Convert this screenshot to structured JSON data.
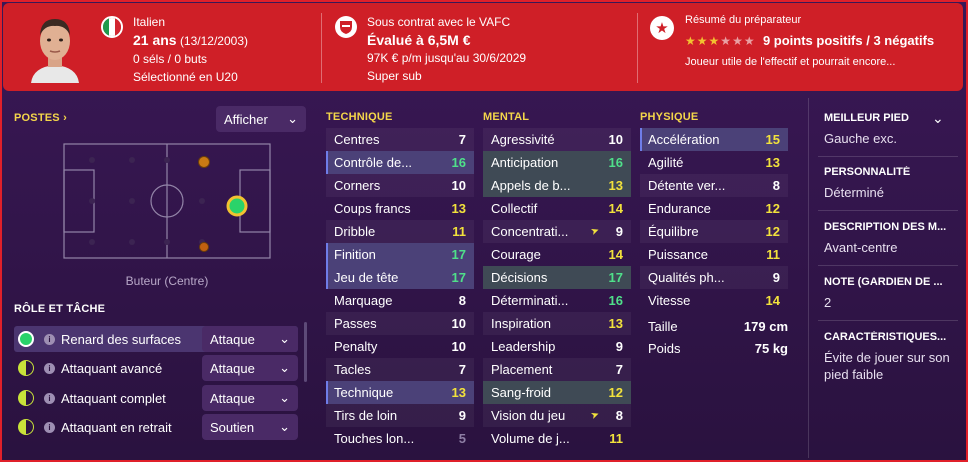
{
  "header": {
    "nationality": "Italien",
    "age": "21 ans",
    "dob": "(13/12/2003)",
    "caps": "0 séls / 0 buts",
    "u20": "Sélectionné en U20",
    "contract": "Sous contrat avec le VAFC",
    "value": "Évalué à 6,5M €",
    "wage": "97K € p/m jusqu'au 30/6/2029",
    "role_status": "Super sub",
    "scout_title": "Résumé du préparateur",
    "stars_filled": 3,
    "stars_total": 6,
    "scout_summary": "9 points positifs / 3 négatifs",
    "scout_text": "Joueur utile de l'effectif et pourrait encore...",
    "club_badge": "VAFC"
  },
  "positions": {
    "title": "POSTES",
    "button": "Afficher",
    "label": "Buteur (Centre)"
  },
  "roles": {
    "title": "RÔLE ET TÂCHE",
    "items": [
      {
        "name": "Renard des surfaces",
        "duty": "Attaque"
      },
      {
        "name": "Attaquant avancé",
        "duty": "Attaque"
      },
      {
        "name": "Attaquant complet",
        "duty": "Attaque"
      },
      {
        "name": "Attaquant en retrait",
        "duty": "Soutien"
      }
    ]
  },
  "technique": {
    "title": "TECHNIQUE",
    "rows": [
      {
        "name": "Centres",
        "value": "7",
        "color": "white"
      },
      {
        "name": "Contrôle de...",
        "value": "16",
        "color": "green"
      },
      {
        "name": "Corners",
        "value": "10",
        "color": "white"
      },
      {
        "name": "Coups francs",
        "value": "13",
        "color": "yellow"
      },
      {
        "name": "Dribble",
        "value": "11",
        "color": "yellow"
      },
      {
        "name": "Finition",
        "value": "17",
        "color": "green"
      },
      {
        "name": "Jeu de tête",
        "value": "17",
        "color": "green"
      },
      {
        "name": "Marquage",
        "value": "8",
        "color": "white"
      },
      {
        "name": "Passes",
        "value": "10",
        "color": "white"
      },
      {
        "name": "Penalty",
        "value": "10",
        "color": "white"
      },
      {
        "name": "Tacles",
        "value": "7",
        "color": "white"
      },
      {
        "name": "Technique",
        "value": "13",
        "color": "yellow"
      },
      {
        "name": "Tirs de loin",
        "value": "9",
        "color": "white"
      },
      {
        "name": "Touches lon...",
        "value": "5",
        "color": "grey"
      }
    ]
  },
  "mental": {
    "title": "MENTAL",
    "rows": [
      {
        "name": "Agressivité",
        "value": "10",
        "color": "white"
      },
      {
        "name": "Anticipation",
        "value": "16",
        "color": "green"
      },
      {
        "name": "Appels de b...",
        "value": "13",
        "color": "yellow"
      },
      {
        "name": "Collectif",
        "value": "14",
        "color": "yellow"
      },
      {
        "name": "Concentrati...",
        "value": "9",
        "color": "white"
      },
      {
        "name": "Courage",
        "value": "14",
        "color": "yellow"
      },
      {
        "name": "Décisions",
        "value": "17",
        "color": "green"
      },
      {
        "name": "Déterminati...",
        "value": "16",
        "color": "green"
      },
      {
        "name": "Inspiration",
        "value": "13",
        "color": "yellow"
      },
      {
        "name": "Leadership",
        "value": "9",
        "color": "white"
      },
      {
        "name": "Placement",
        "value": "7",
        "color": "white"
      },
      {
        "name": "Sang-froid",
        "value": "12",
        "color": "yellow"
      },
      {
        "name": "Vision du jeu",
        "value": "8",
        "color": "white"
      },
      {
        "name": "Volume de j...",
        "value": "11",
        "color": "yellow"
      }
    ]
  },
  "physique": {
    "title": "PHYSIQUE",
    "rows": [
      {
        "name": "Accélération",
        "value": "15",
        "color": "yellow"
      },
      {
        "name": "Agilité",
        "value": "13",
        "color": "yellow"
      },
      {
        "name": "Détente ver...",
        "value": "8",
        "color": "white"
      },
      {
        "name": "Endurance",
        "value": "12",
        "color": "yellow"
      },
      {
        "name": "Équilibre",
        "value": "12",
        "color": "yellow"
      },
      {
        "name": "Puissance",
        "value": "11",
        "color": "yellow"
      },
      {
        "name": "Qualités ph...",
        "value": "9",
        "color": "white"
      },
      {
        "name": "Vitesse",
        "value": "14",
        "color": "yellow"
      }
    ],
    "height_label": "Taille",
    "height_value": "179 cm",
    "weight_label": "Poids",
    "weight_value": "75 kg"
  },
  "side": {
    "foot_label": "MEILLEUR PIED",
    "foot_value": "Gauche exc.",
    "personality_label": "PERSONNALITÉ",
    "personality_value": "Déterminé",
    "description_label": "DESCRIPTION DES M...",
    "description_value": "Avant-centre",
    "gk_label": "NOTE (GARDIEN DE ...",
    "gk_value": "2",
    "traits_label": "CARACTÉRISTIQUES...",
    "traits_value": "Évite de jouer sur son pied faible"
  },
  "colors": {
    "header_red": "#cf1f27",
    "background": "#2b1340",
    "green": "#4fe08a",
    "yellow": "#f2e23c",
    "section_yellow": "#f4d64a"
  },
  "icons": {
    "flag": "italy-flag-icon",
    "badge": "club-badge-icon",
    "star": "star-icon",
    "chevron": "chevron-down-icon"
  }
}
